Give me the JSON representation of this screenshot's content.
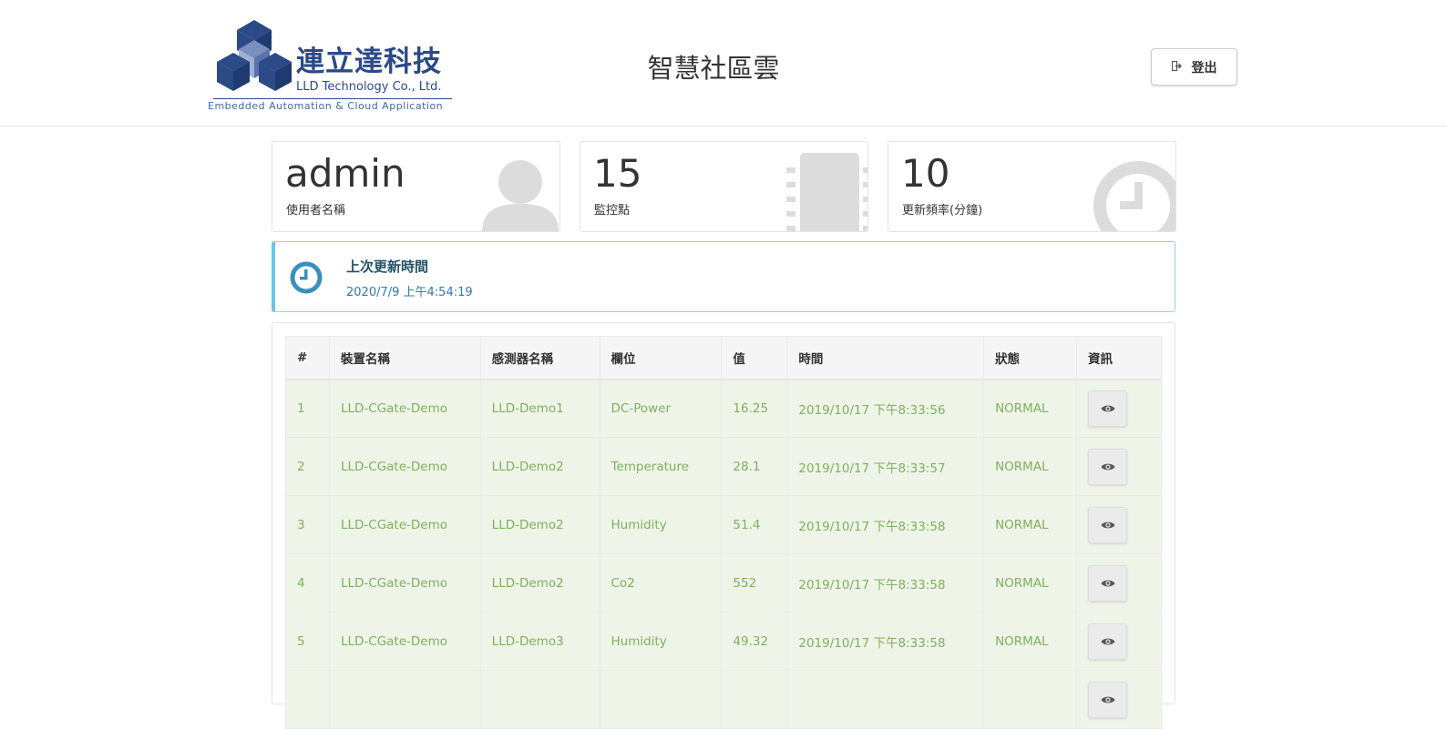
{
  "header": {
    "logo_cn": "連立達科技",
    "logo_en": "LLD Technology Co., Ltd.",
    "logo_tagline": "Embedded Automation & Cloud Application",
    "site_title": "智慧社區雲",
    "logout_label": "登出"
  },
  "stats": [
    {
      "value": "admin",
      "label": "使用者名稱",
      "icon": "user-icon"
    },
    {
      "value": "15",
      "label": "監控點",
      "icon": "chip-icon"
    },
    {
      "value": "10",
      "label": "更新頻率(分鐘)",
      "icon": "clock-icon"
    }
  ],
  "update_notice": {
    "title": "上次更新時間",
    "time": "2020/7/9 上午4:54:19"
  },
  "table": {
    "headers": [
      "#",
      "裝置名稱",
      "感測器名稱",
      "欄位",
      "值",
      "時間",
      "狀態",
      "資訊"
    ],
    "rows": [
      {
        "idx": "1",
        "device": "LLD-CGate-Demo",
        "sensor": "LLD-Demo1",
        "field": "DC-Power",
        "value": "16.25",
        "time": "2019/10/17 下午8:33:56",
        "status": "NORMAL"
      },
      {
        "idx": "2",
        "device": "LLD-CGate-Demo",
        "sensor": "LLD-Demo2",
        "field": "Temperature",
        "value": "28.1",
        "time": "2019/10/17 下午8:33:57",
        "status": "NORMAL"
      },
      {
        "idx": "3",
        "device": "LLD-CGate-Demo",
        "sensor": "LLD-Demo2",
        "field": "Humidity",
        "value": "51.4",
        "time": "2019/10/17 下午8:33:58",
        "status": "NORMAL"
      },
      {
        "idx": "4",
        "device": "LLD-CGate-Demo",
        "sensor": "LLD-Demo2",
        "field": "Co2",
        "value": "552",
        "time": "2019/10/17 下午8:33:58",
        "status": "NORMAL"
      },
      {
        "idx": "5",
        "device": "LLD-CGate-Demo",
        "sensor": "LLD-Demo3",
        "field": "Humidity",
        "value": "49.32",
        "time": "2019/10/17 下午8:33:58",
        "status": "NORMAL"
      },
      {
        "idx": "",
        "device": "",
        "sensor": "",
        "field": "",
        "value": "",
        "time": "",
        "status": ""
      }
    ]
  },
  "colors": {
    "brand": "#2b4a86",
    "row_text": "#7eb05c",
    "row_bg": "#eff4e8",
    "alert_border": "#6cc4e6",
    "alert_title": "#245269"
  }
}
